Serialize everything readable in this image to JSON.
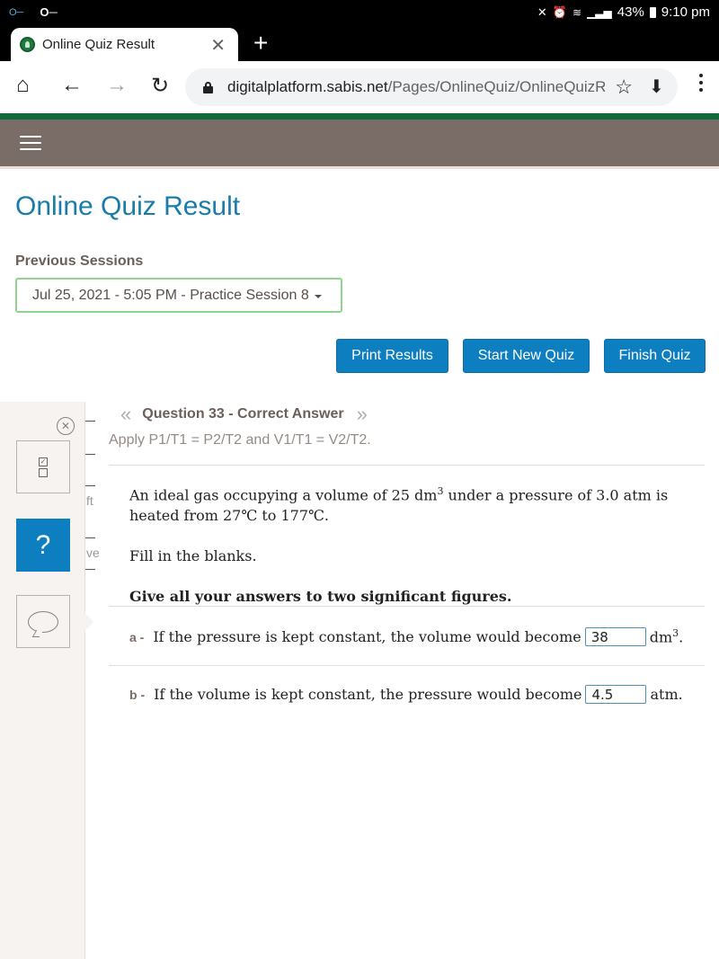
{
  "status_bar": {
    "left_icons": [
      "vpn-key-icon",
      "key-icon"
    ],
    "right_icons": [
      "mute-vibrate-icon",
      "alarm-icon",
      "wifi-icon",
      "signal-icon"
    ],
    "battery": "43%",
    "time": "9:10 pm"
  },
  "browser": {
    "tab_title": "Online Quiz Result",
    "tab_close": "✕",
    "new_tab": "+",
    "url_domain": "digitalplatform.sabis.net",
    "url_path": "/Pages/OnlineQuiz/OnlineQuizR",
    "nav": {
      "home": "⌂",
      "back": "←",
      "forward": "→",
      "reload": "↻",
      "bookmark": "☆",
      "download": "⬇"
    }
  },
  "page": {
    "title": "Online Quiz Result",
    "previous_sessions_label": "Previous Sessions",
    "selected_session": "Jul 25, 2021 - 5:05 PM - Practice Session 8",
    "buttons": {
      "print": "Print Results",
      "start_new": "Start New Quiz",
      "finish": "Finish Quiz"
    },
    "colors": {
      "accent": "#0d7ebf",
      "title": "#1a7ca8",
      "header": "#7a6c66",
      "brand_green": "#0f6b3a",
      "select_border": "#8fd48f"
    }
  },
  "side_panel": {
    "close": "✕",
    "help": "?",
    "behind_text_1": "ft",
    "behind_text_2": "ve"
  },
  "question": {
    "prev_arrow": "«",
    "next_arrow": "»",
    "title": "Question 33 - Correct Answer",
    "hint": "Apply P1/T1 = P2/T2 and V1/T1 = V2/T2.",
    "stem_part1": "An ideal gas occupying a volume of 25 dm",
    "stem_sup": "3",
    "stem_part2": " under a pressure of 3.0 atm is heated from 27℃ to 177℃.",
    "instruction": "Fill in the blanks.",
    "note": "Give all your answers to two significant figures.",
    "answers": [
      {
        "letter": "a -",
        "text": "If the pressure is kept constant, the volume would become",
        "value": "38",
        "unit": "dm",
        "unit_sup": "3",
        "unit_end": "."
      },
      {
        "letter": "b -",
        "text": "If the volume is kept constant, the pressure would become",
        "value": "4.5",
        "unit": "atm.",
        "unit_sup": "",
        "unit_end": ""
      }
    ]
  }
}
